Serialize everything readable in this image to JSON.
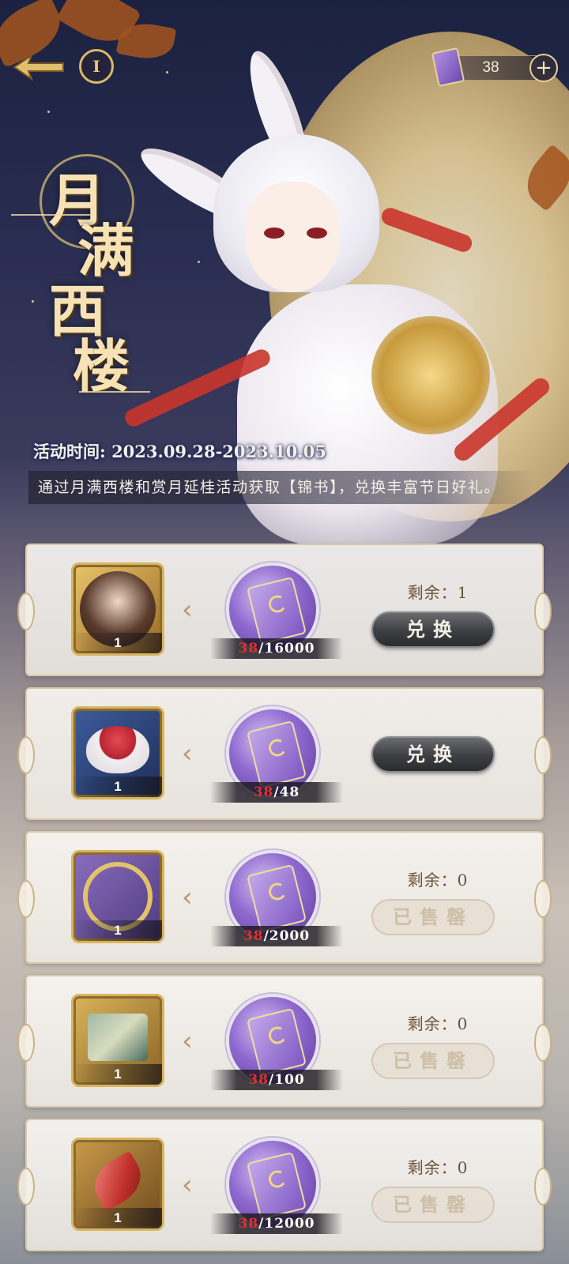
{
  "topbar": {
    "currency_count": "38",
    "add_symbol": "+"
  },
  "title": {
    "chars": [
      "月",
      "满",
      "西",
      "楼"
    ]
  },
  "event": {
    "time_text": "活动时间: 2023.09.28-2023.10.05",
    "description": "通过月满西楼和赏月延桂活动获取【锦书】，兑换丰富节日好礼。"
  },
  "shop": {
    "rows": [
      {
        "item_name": "character-portrait",
        "item_qty": "1",
        "cost_have": "38",
        "cost_need": "/16000",
        "remain_text": "剩余：1",
        "button_label": "兑换",
        "state": "available"
      },
      {
        "item_name": "red-bean-soup",
        "item_qty": "1",
        "cost_have": "38",
        "cost_need": "/48",
        "remain_text": "",
        "button_label": "兑换",
        "state": "available"
      },
      {
        "item_name": "moon-frame",
        "item_qty": "1",
        "cost_have": "38",
        "cost_need": "/2000",
        "remain_text": "剩余：0",
        "button_label": "已售罄",
        "state": "soldout"
      },
      {
        "item_name": "envelope-gift",
        "item_qty": "1",
        "cost_have": "38",
        "cost_need": "/100",
        "remain_text": "剩余：0",
        "button_label": "已售罄",
        "state": "soldout"
      },
      {
        "item_name": "red-feather",
        "item_qty": "1",
        "cost_have": "38",
        "cost_need": "/12000",
        "remain_text": "剩余：0",
        "button_label": "已售罄",
        "state": "soldout"
      }
    ]
  },
  "colors": {
    "accent_gold": "#d9b86a",
    "cost_have_red": "#e0312f",
    "currency_purple": "#8f69cf"
  }
}
